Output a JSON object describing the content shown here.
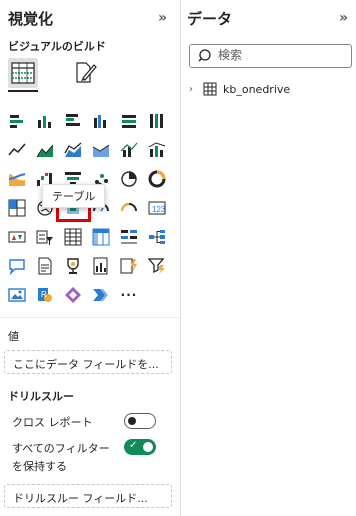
{
  "viz_pane": {
    "title": "視覚化",
    "collapse_glyph": "»",
    "subtitle": "ビジュアルのビルド",
    "build_tabs": [
      {
        "name": "build-visual-tab",
        "icon": "table-build-icon",
        "active": true
      },
      {
        "name": "format-visual-tab",
        "icon": "format-paintbrush-icon",
        "active": false
      }
    ],
    "visual_icons": [
      "stacked-bar-chart-icon",
      "stacked-column-chart-icon",
      "clustered-bar-chart-icon",
      "clustered-column-chart-icon",
      "100-stacked-bar-chart-icon",
      "100-stacked-column-chart-icon",
      "line-chart-icon",
      "area-chart-icon",
      "stacked-area-chart-icon",
      "100-stacked-area-chart-icon",
      "line-and-stacked-column-chart-icon",
      "line-and-clustered-column-chart-icon",
      "ribbon-chart-icon",
      "waterfall-chart-icon",
      "funnel-chart-icon",
      "scatter-chart-icon",
      "pie-chart-icon",
      "donut-chart-icon",
      "treemap-icon",
      "map-icon",
      "filled-map-icon",
      "azure-map-icon",
      "gauge-icon",
      "card-icon",
      "kpi-icon",
      "slicer-icon",
      "table-icon",
      "matrix-icon",
      "multi-row-card-icon",
      "decomposition-tree-icon",
      "smart-narrative-icon",
      "paginated-report-icon",
      "trophy-goals-icon",
      "key-influencers-icon",
      "power-automate-icon",
      "qa-filter-icon",
      "image-icon",
      "r-script-visual-icon",
      "power-apps-icon",
      "power-automate-flow-icon",
      "more-visuals-icon"
    ],
    "tooltip": "テーブル",
    "more_label": "···",
    "values_label": "値",
    "values_placeholder": "ここにデータ フィールドを...",
    "drillthrough_label": "ドリルスルー",
    "cross_report_label": "クロス レポート",
    "cross_report_on": false,
    "keep_filters_label_1": "すべてのフィルター",
    "keep_filters_label_2": "を保持する",
    "keep_filters_on": true,
    "drillthrough_placeholder": "ドリルスルー フィールド...",
    "toggle_on_color": "#118b57",
    "selection_color": "#e00000"
  },
  "data_pane": {
    "title": "データ",
    "collapse_glyph": "»",
    "search_placeholder": "検索",
    "tables": [
      {
        "name": "kb_onedrive",
        "icon": "table-icon",
        "expanded": false
      }
    ]
  }
}
